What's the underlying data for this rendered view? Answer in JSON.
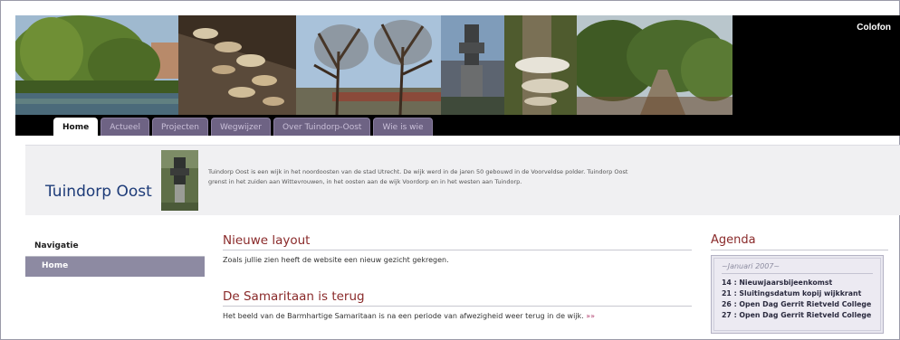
{
  "header": {
    "colofon_label": "Colofon",
    "banner_photos": [
      "willow-pond-photo",
      "mushrooms-photo",
      "bare-trees-photo",
      "statue-photo",
      "bracket-fungus-photo",
      "garden-path-photo"
    ]
  },
  "tabs": [
    {
      "label": "Home",
      "active": true
    },
    {
      "label": "Actueel",
      "active": false
    },
    {
      "label": "Projecten",
      "active": false
    },
    {
      "label": "Wegwijzer",
      "active": false
    },
    {
      "label": "Over Tuindorp-Oost",
      "active": false
    },
    {
      "label": "Wie is wie",
      "active": false
    }
  ],
  "intro": {
    "site_title": "Tuindorp Oost",
    "description": "Tuindorp Oost is een wijk in het noordoosten van de stad Utrecht. De wijk werd in de jaren 50 gebouwd in de Voorveldse polder. Tuindorp Oost grenst in het zuiden aan Wittevrouwen, in het oosten aan de wijk Voordorp en in het westen aan Tuindorp."
  },
  "navigation": {
    "heading": "Navigatie",
    "items": [
      {
        "label": "Home"
      }
    ]
  },
  "articles": [
    {
      "title": "Nieuwe layout",
      "body": "Zoals jullie zien heeft de website een nieuw gezicht gekregen.",
      "more": ""
    },
    {
      "title": "De Samaritaan is terug",
      "body": "Het beeld van de Barmhartige Samaritaan is na een periode van afwezigheid weer terug in de wijk.",
      "more": "»»"
    }
  ],
  "agenda": {
    "heading": "Agenda",
    "month": "~Januari 2007~",
    "items": [
      {
        "text": "14 : Nieuwjaarsbijeenkomst"
      },
      {
        "text": "21 : Sluitingsdatum kopij wijkkrant"
      },
      {
        "text": "26 : Open Dag Gerrit Rietveld College"
      },
      {
        "text": "27 : Open Dag Gerrit Rietveld College"
      }
    ]
  },
  "colors": {
    "header_bg": "#000000",
    "tab_inactive": "#6e6384",
    "title_blue": "#1d3b78",
    "heading_red": "#8a2a2a",
    "nav_active": "#8d8aa2",
    "link_pink": "#b03c6c"
  }
}
